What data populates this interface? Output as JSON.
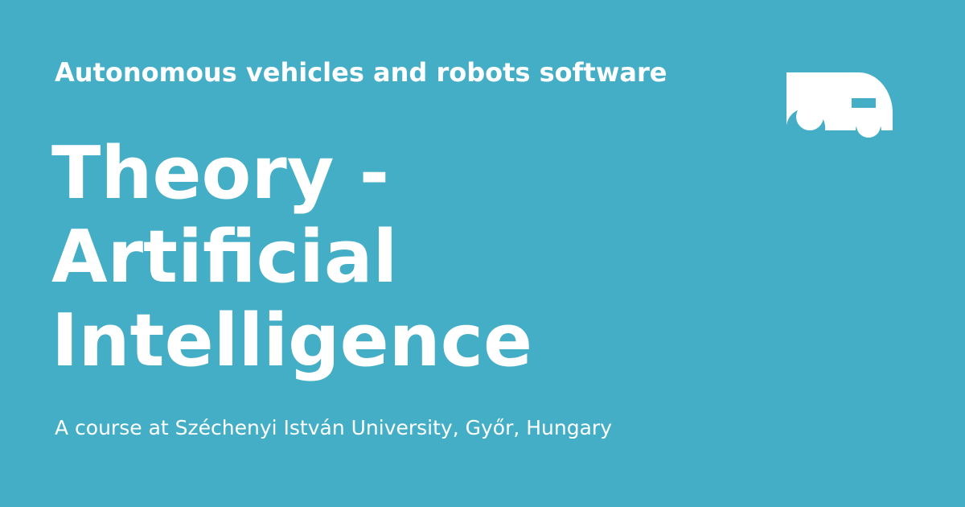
{
  "header": {
    "site_name": "Autonomous vehicles and robots software"
  },
  "main": {
    "title": "Theory - Artificial Intelligence",
    "subtitle": "A course at Széchenyi István University, Győr, Hungary"
  },
  "logo": {
    "icon": "vehicle-icon"
  },
  "colors": {
    "background": "#43aec6",
    "text": "#ffffff"
  }
}
